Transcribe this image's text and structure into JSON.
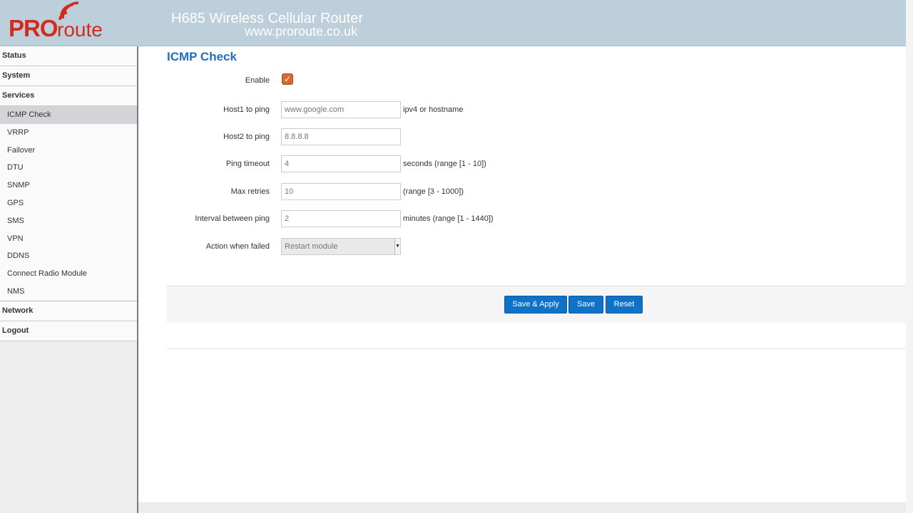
{
  "header": {
    "logo_pro": "PRO",
    "logo_route": "route",
    "title": "H685 Wireless Cellular Router",
    "url": "www.proroute.co.uk"
  },
  "sidebar": {
    "top_items": {
      "status": "Status",
      "system": "System",
      "services": "Services",
      "network": "Network",
      "logout": "Logout"
    },
    "services_items": [
      "ICMP Check",
      "VRRP",
      "Failover",
      "DTU",
      "SNMP",
      "GPS",
      "SMS",
      "VPN",
      "DDNS",
      "Connect Radio Module",
      "NMS"
    ],
    "active_item": "ICMP Check"
  },
  "page": {
    "title": "ICMP Check",
    "fields": {
      "enable": {
        "label": "Enable",
        "checked": true
      },
      "host1": {
        "label": "Host1 to ping",
        "placeholder": "www.google.com",
        "hint": "ipv4 or hostname"
      },
      "host2": {
        "label": "Host2 to ping",
        "placeholder": "8.8.8.8"
      },
      "timeout": {
        "label": "Ping timeout",
        "value": "4",
        "hint": "seconds (range [1 - 10])"
      },
      "retries": {
        "label": "Max retries",
        "value": "10",
        "hint": "(range [3 - 1000])"
      },
      "interval": {
        "label": "Interval between ping",
        "value": "2",
        "hint": "minutes (range [1 - 1440])"
      },
      "action": {
        "label": "Action when failed",
        "selected": "Restart module"
      }
    },
    "buttons": {
      "save_apply": "Save & Apply",
      "save": "Save",
      "reset": "Reset"
    }
  },
  "colors": {
    "header_bg": "#bccfdb",
    "brand_red": "#d42a1e",
    "title_blue": "#1e6fc2",
    "button_blue": "#0f72c9",
    "checkbox_orange": "#d9682e"
  }
}
